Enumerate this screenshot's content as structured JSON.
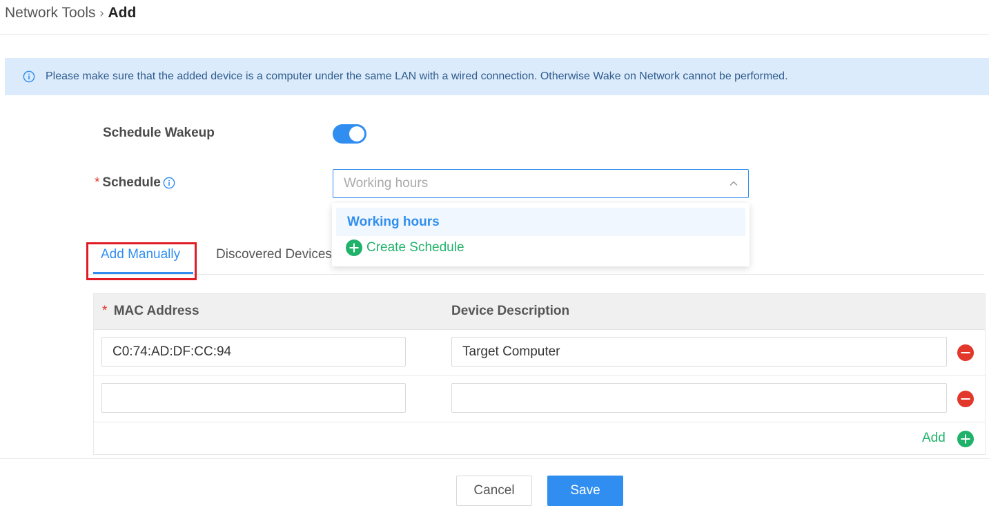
{
  "breadcrumb": {
    "parent": "Network Tools",
    "separator": "›",
    "current": "Add"
  },
  "alert": {
    "text": "Please make sure that the added device is a computer under the same LAN with a wired connection. Otherwise Wake on Network cannot be performed."
  },
  "form": {
    "schedule_wakeup_label": "Schedule Wakeup",
    "schedule_wakeup_on": true,
    "required_mark": "*",
    "schedule_label": "Schedule",
    "schedule_placeholder": "Working hours"
  },
  "dropdown": {
    "options": [
      "Working hours"
    ],
    "create_label": "Create Schedule"
  },
  "tabs": [
    {
      "label": "Add Manually",
      "active": true
    },
    {
      "label": "Discovered Devices",
      "active": false
    }
  ],
  "table": {
    "required_mark": "*",
    "col_mac": "MAC Address",
    "col_desc": "Device Description",
    "rows": [
      {
        "mac": "C0:74:AD:DF:CC:94",
        "desc": "Target Computer"
      },
      {
        "mac": "",
        "desc": ""
      }
    ],
    "add_label": "Add"
  },
  "footer": {
    "cancel_label": "Cancel",
    "save_label": "Save"
  },
  "colors": {
    "primary": "#2f8ef0",
    "success": "#20b26b",
    "danger": "#e2372b",
    "highlight": "#e01b24"
  }
}
